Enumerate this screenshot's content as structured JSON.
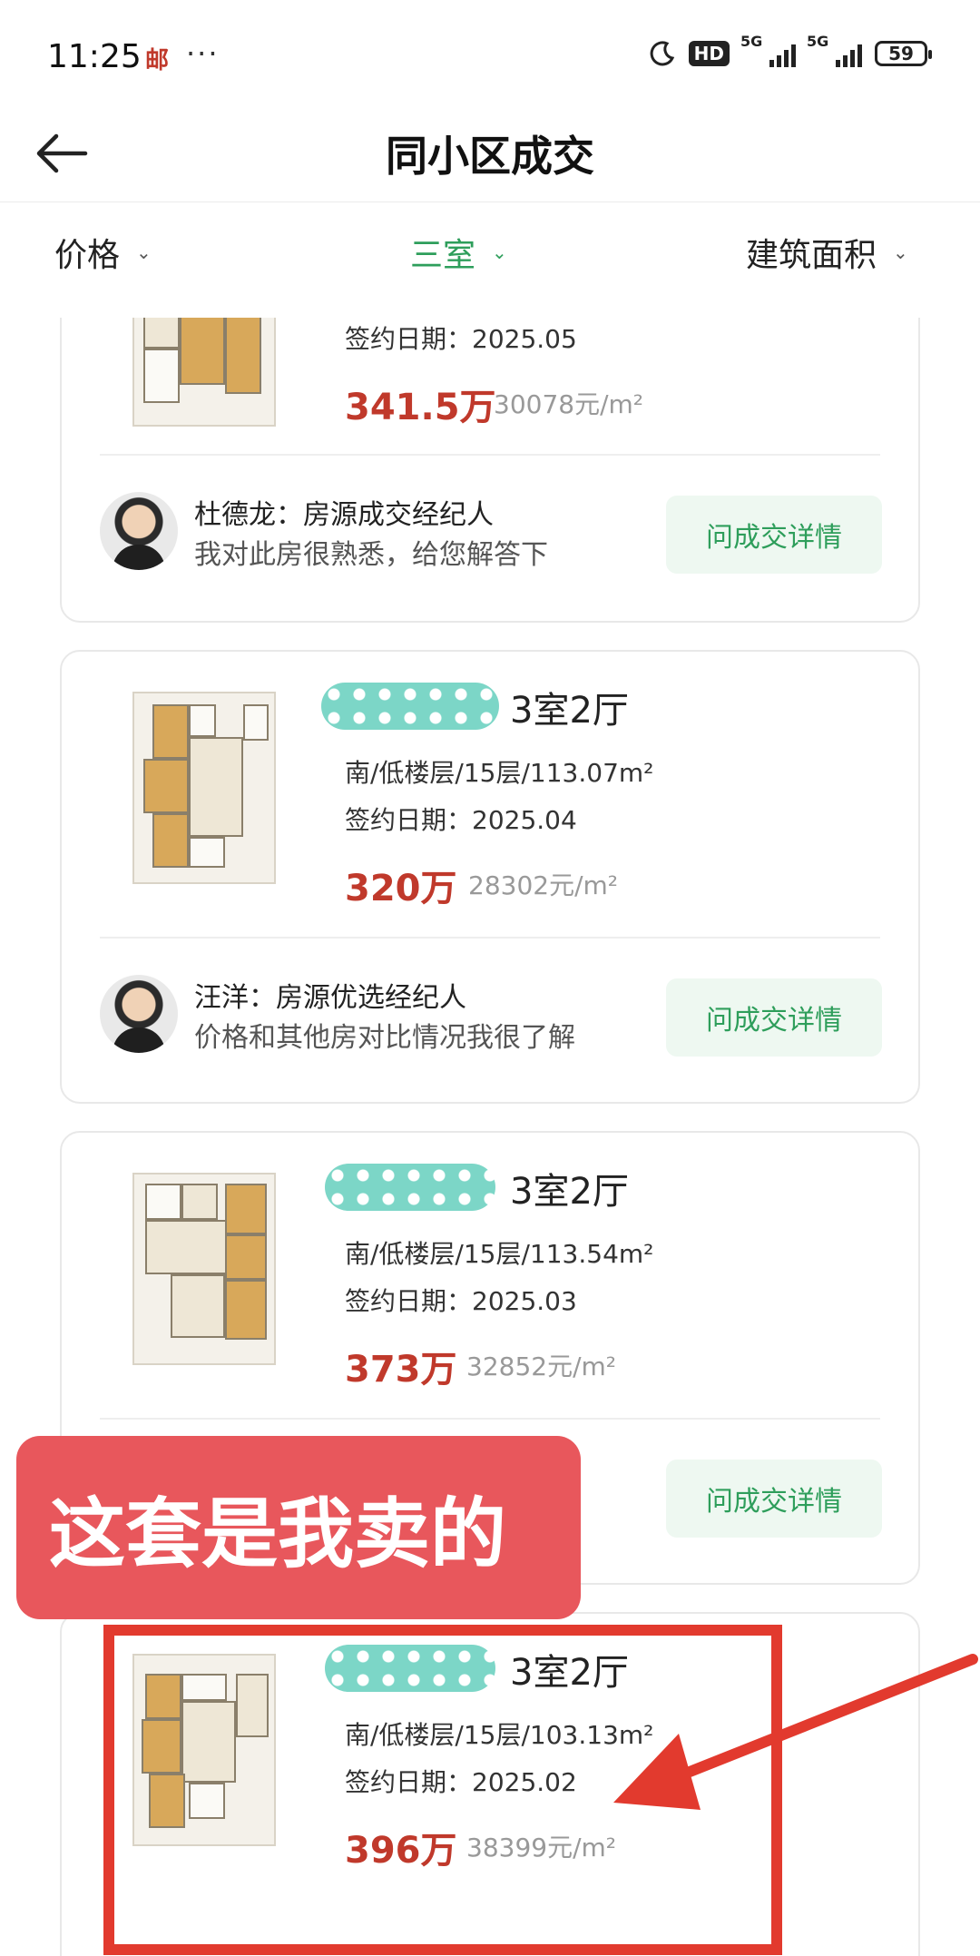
{
  "status_bar": {
    "time": "11:25",
    "mail_icon": "邮",
    "dots": "···",
    "hd": "HD",
    "net1": "5G",
    "net2": "5G",
    "battery": "59"
  },
  "header": {
    "title": "同小区成交"
  },
  "filters": [
    {
      "label": "价格",
      "active": false
    },
    {
      "label": "三室",
      "active": true
    },
    {
      "label": "建筑面积",
      "active": false
    }
  ],
  "cards": [
    {
      "date": "签约日期：2025.05",
      "price": "341.5万",
      "unit_price": "30078元/m²",
      "agent": {
        "name": "杜德龙：房源成交经纪人",
        "desc": "我对此房很熟悉，给您解答下"
      },
      "ask_label": "问成交详情"
    },
    {
      "layout": "3室2厅",
      "details": "南/低楼层/15层/113.07m²",
      "date": "签约日期：2025.04",
      "price": "320万",
      "unit_price": "28302元/m²",
      "agent": {
        "name": "汪洋：房源优选经纪人",
        "desc": "价格和其他房对比情况我很了解"
      },
      "ask_label": "问成交详情"
    },
    {
      "layout": "3室2厅",
      "details": "南/低楼层/15层/113.54m²",
      "date": "签约日期：2025.03",
      "price": "373万",
      "unit_price": "32852元/m²",
      "ask_label": "问成交详情"
    },
    {
      "layout": "3室2厅",
      "details": "南/低楼层/15层/103.13m²",
      "date": "签约日期：2025.02",
      "price": "396万",
      "unit_price": "38399元/m²"
    }
  ],
  "annotation": {
    "text": "这套是我卖的",
    "color": "#e8575c",
    "highlight_color": "#e23a2e"
  },
  "colors": {
    "accent": "#2e9e5b",
    "price": "#c0392b"
  }
}
